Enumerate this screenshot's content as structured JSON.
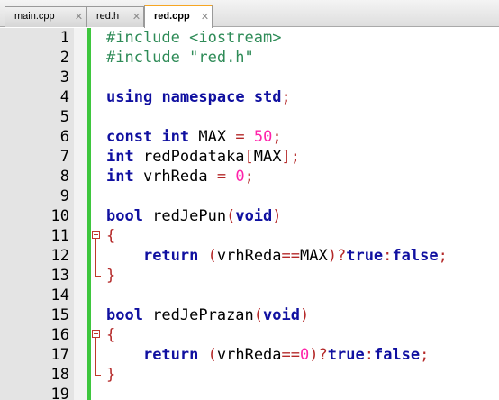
{
  "tabs": [
    {
      "label": "main.cpp",
      "active": false,
      "close_icon": "close-icon"
    },
    {
      "label": "red.h",
      "active": false,
      "close_icon": "close-icon"
    },
    {
      "label": "red.cpp",
      "active": true,
      "close_icon": "close-icon"
    }
  ],
  "colors": {
    "preprocessor": "#2e8b57",
    "keyword": "#1010a0",
    "number": "#ff22aa",
    "operator": "#b42828",
    "change_bar": "#3ec63e",
    "active_tab_accent": "#f6a623",
    "gutter": "#e4e4e4"
  },
  "lines": [
    {
      "n": "1",
      "fold": "",
      "tokens": [
        [
          "pre",
          "#include <iostream>"
        ]
      ]
    },
    {
      "n": "2",
      "fold": "",
      "tokens": [
        [
          "pre",
          "#include "
        ],
        [
          "str",
          "\"red.h\""
        ]
      ]
    },
    {
      "n": "3",
      "fold": "",
      "tokens": []
    },
    {
      "n": "4",
      "fold": "",
      "tokens": [
        [
          "kw",
          "using"
        ],
        [
          "id",
          " "
        ],
        [
          "kw",
          "namespace"
        ],
        [
          "id",
          " "
        ],
        [
          "kw",
          "std"
        ],
        [
          "op",
          ";"
        ]
      ]
    },
    {
      "n": "5",
      "fold": "",
      "tokens": []
    },
    {
      "n": "6",
      "fold": "",
      "tokens": [
        [
          "kw",
          "const"
        ],
        [
          "id",
          " "
        ],
        [
          "kw",
          "int"
        ],
        [
          "id",
          " MAX "
        ],
        [
          "op",
          "="
        ],
        [
          "id",
          " "
        ],
        [
          "num",
          "50"
        ],
        [
          "op",
          ";"
        ]
      ]
    },
    {
      "n": "7",
      "fold": "",
      "tokens": [
        [
          "kw",
          "int"
        ],
        [
          "id",
          " redPodataka"
        ],
        [
          "op",
          "["
        ],
        [
          "id",
          "MAX"
        ],
        [
          "op",
          "];"
        ]
      ]
    },
    {
      "n": "8",
      "fold": "",
      "tokens": [
        [
          "kw",
          "int"
        ],
        [
          "id",
          " vrhReda "
        ],
        [
          "op",
          "="
        ],
        [
          "id",
          " "
        ],
        [
          "num",
          "0"
        ],
        [
          "op",
          ";"
        ]
      ]
    },
    {
      "n": "9",
      "fold": "",
      "tokens": []
    },
    {
      "n": "10",
      "fold": "",
      "tokens": [
        [
          "kw",
          "bool"
        ],
        [
          "id",
          " redJePun"
        ],
        [
          "op",
          "("
        ],
        [
          "kw",
          "void"
        ],
        [
          "op",
          ")"
        ]
      ]
    },
    {
      "n": "11",
      "fold": "open",
      "tokens": [
        [
          "op",
          "{"
        ]
      ]
    },
    {
      "n": "12",
      "fold": "mid",
      "tokens": [
        [
          "id",
          "    "
        ],
        [
          "kw",
          "return"
        ],
        [
          "id",
          " "
        ],
        [
          "op",
          "("
        ],
        [
          "id",
          "vrhReda"
        ],
        [
          "op",
          "=="
        ],
        [
          "id",
          "MAX"
        ],
        [
          "op",
          ")?"
        ],
        [
          "kw",
          "true"
        ],
        [
          "op",
          ":"
        ],
        [
          "kw",
          "false"
        ],
        [
          "op",
          ";"
        ]
      ]
    },
    {
      "n": "13",
      "fold": "end",
      "tokens": [
        [
          "op",
          "}"
        ]
      ]
    },
    {
      "n": "14",
      "fold": "",
      "tokens": []
    },
    {
      "n": "15",
      "fold": "",
      "tokens": [
        [
          "kw",
          "bool"
        ],
        [
          "id",
          " redJePrazan"
        ],
        [
          "op",
          "("
        ],
        [
          "kw",
          "void"
        ],
        [
          "op",
          ")"
        ]
      ]
    },
    {
      "n": "16",
      "fold": "open",
      "tokens": [
        [
          "op",
          "{"
        ]
      ]
    },
    {
      "n": "17",
      "fold": "mid",
      "tokens": [
        [
          "id",
          "    "
        ],
        [
          "kw",
          "return"
        ],
        [
          "id",
          " "
        ],
        [
          "op",
          "("
        ],
        [
          "id",
          "vrhReda"
        ],
        [
          "op",
          "=="
        ],
        [
          "num",
          "0"
        ],
        [
          "op",
          ")?"
        ],
        [
          "kw",
          "true"
        ],
        [
          "op",
          ":"
        ],
        [
          "kw",
          "false"
        ],
        [
          "op",
          ";"
        ]
      ]
    },
    {
      "n": "18",
      "fold": "end",
      "tokens": [
        [
          "op",
          "}"
        ]
      ]
    },
    {
      "n": "19",
      "fold": "",
      "tokens": []
    }
  ]
}
